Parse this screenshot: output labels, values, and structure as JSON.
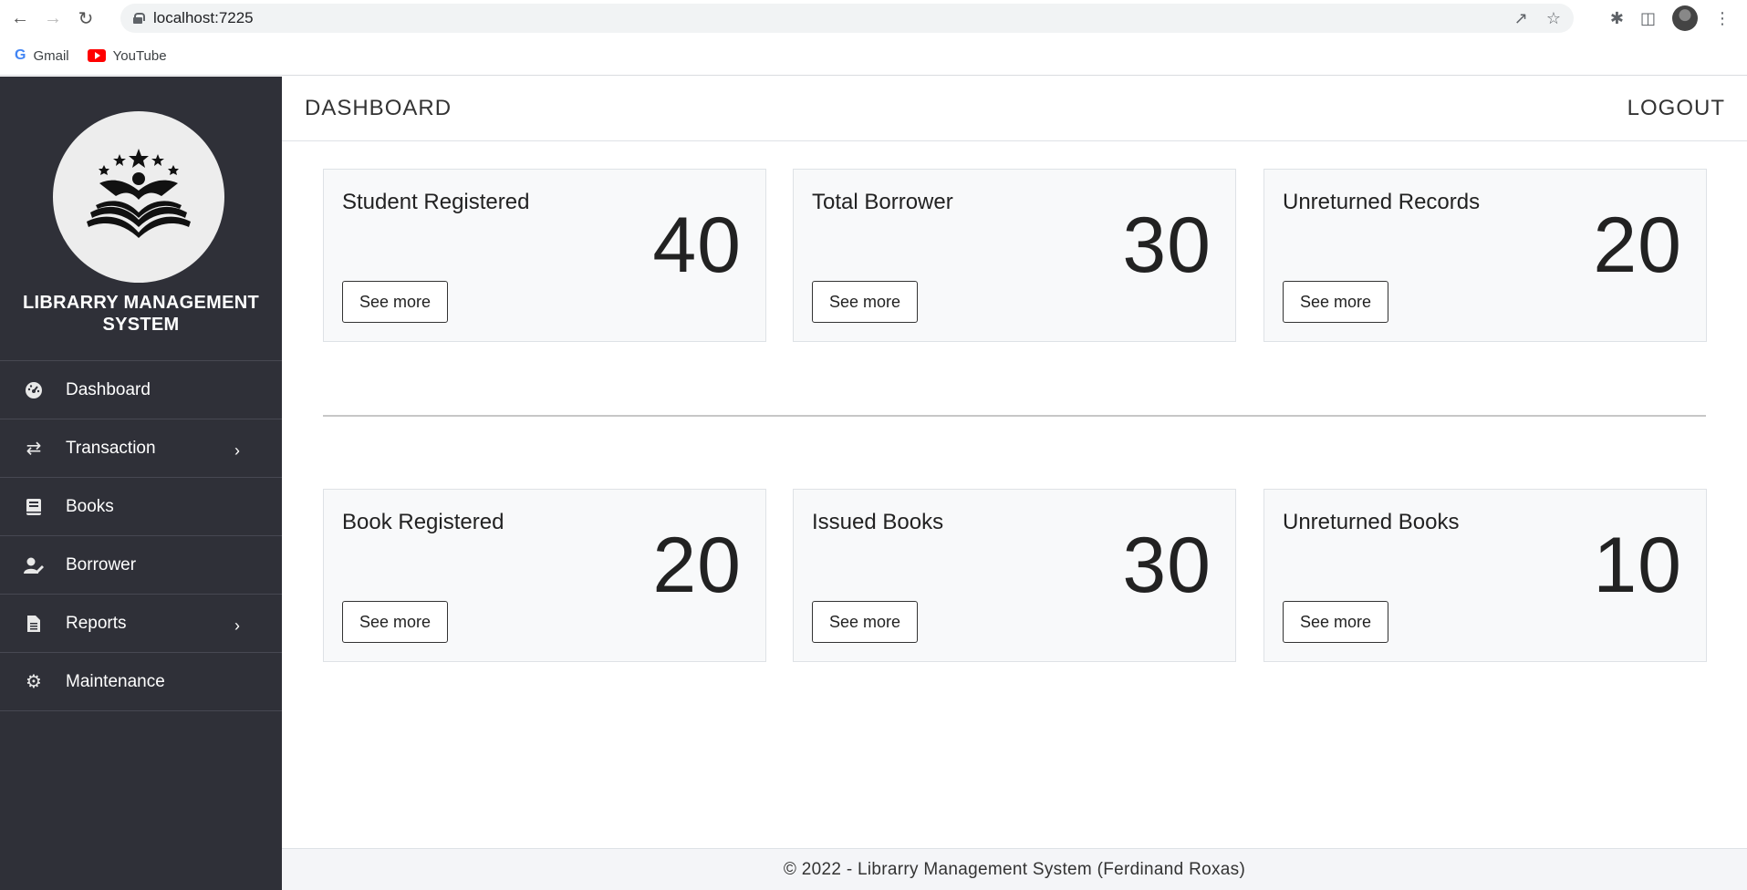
{
  "browser": {
    "url": "localhost:7225",
    "bookmarks": [
      {
        "label": "Gmail",
        "icon": "google-icon"
      },
      {
        "label": "YouTube",
        "icon": "youtube-icon"
      }
    ]
  },
  "sidebar": {
    "app_title_line1": "LIBRARRY MANAGEMENT",
    "app_title_line2": "SYSTEM",
    "items": [
      {
        "label": "Dashboard",
        "icon": "dashboard-icon"
      },
      {
        "label": "Transaction",
        "icon": "exchange-icon",
        "has_submenu": true
      },
      {
        "label": "Books",
        "icon": "book-icon"
      },
      {
        "label": "Borrower",
        "icon": "user-edit-icon"
      },
      {
        "label": "Reports",
        "icon": "file-icon",
        "has_submenu": true
      },
      {
        "label": "Maintenance",
        "icon": "gear-icon"
      }
    ]
  },
  "header": {
    "title": "DASHBOARD",
    "logout_label": "LOGOUT"
  },
  "cards": [
    {
      "label": "Student Registered",
      "value": "40",
      "button": "See more"
    },
    {
      "label": "Total Borrower",
      "value": "30",
      "button": "See more"
    },
    {
      "label": "Unreturned Records",
      "value": "20",
      "button": "See more"
    },
    {
      "label": "Book Registered",
      "value": "20",
      "button": "See more"
    },
    {
      "label": "Issued Books",
      "value": "30",
      "button": "See more"
    },
    {
      "label": "Unreturned Books",
      "value": "10",
      "button": "See more"
    }
  ],
  "footer": {
    "text": "© 2022 - Librarry Management System (Ferdinand Roxas)"
  },
  "colors": {
    "sidebar_bg": "#2f3038",
    "card_bg": "#f8f9fa",
    "footer_bg": "#f4f5f8"
  }
}
